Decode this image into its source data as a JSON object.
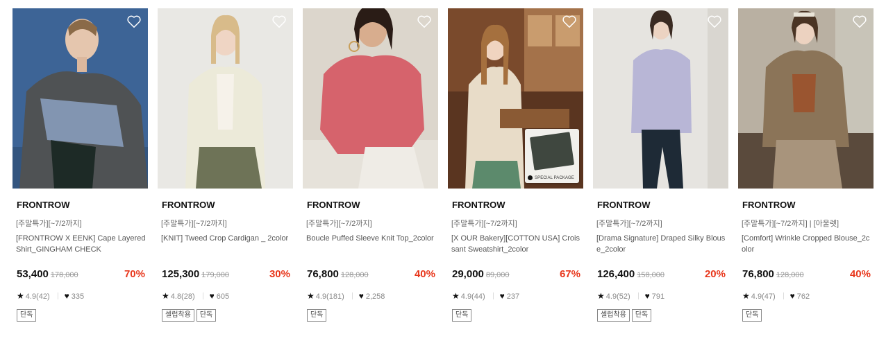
{
  "products": [
    {
      "brand": "FRONTROW",
      "promo": "[주말특가][~7/2까지]",
      "name": "[FRONTROW X EENK] Cape Layered Shirt_GINGHAM CHECK",
      "price": "53,400",
      "original_price": "178,000",
      "discount": "70%",
      "rating": "4.9(42)",
      "likes": "335",
      "tags": [
        "단독"
      ],
      "colors": {
        "bg": "#3d6496",
        "garment": "#55585a"
      }
    },
    {
      "brand": "FRONTROW",
      "promo": "[주말특가][~7/2까지]",
      "name": "[KNIT] Tweed Crop Cardigan _ 2color",
      "price": "125,300",
      "original_price": "179,000",
      "discount": "30%",
      "rating": "4.8(28)",
      "likes": "605",
      "tags": [
        "셀럽착용",
        "단독"
      ],
      "colors": {
        "bg": "#e9e8e4",
        "garment": "#ecead9"
      }
    },
    {
      "brand": "FRONTROW",
      "promo": "[주말특가][~7/2까지]",
      "name": "Boucle Puffed Sleeve Knit Top_2color",
      "price": "76,800",
      "original_price": "128,000",
      "discount": "40%",
      "rating": "4.9(181)",
      "likes": "2,258",
      "tags": [
        "단독"
      ],
      "colors": {
        "bg": "#dcd6cc",
        "garment": "#d6636c"
      }
    },
    {
      "brand": "FRONTROW",
      "promo": "[주말특가][~7/2까지]",
      "name": "[X OUR Bakery][COTTON USA] Croissant Sweatshirt_2color",
      "price": "29,000",
      "original_price": "89,000",
      "discount": "67%",
      "rating": "4.9(44)",
      "likes": "237",
      "tags": [
        "단독"
      ],
      "badge": "SPECIAL PACKAGE",
      "colors": {
        "bg": "#7a4a2c",
        "garment": "#e8dcc8"
      }
    },
    {
      "brand": "FRONTROW",
      "promo": "[주말특가][~7/2까지]",
      "name": "[Drama Signature] Draped Silky Blouse_2color",
      "price": "126,400",
      "original_price": "158,000",
      "discount": "20%",
      "rating": "4.9(52)",
      "likes": "791",
      "tags": [
        "셀럽착용",
        "단독"
      ],
      "colors": {
        "bg": "#e6e4e0",
        "garment": "#b8b6d6"
      }
    },
    {
      "brand": "FRONTROW",
      "promo": "[주말특가][~7/2까지] | [아울렛]",
      "name": "[Comfort] Wrinkle Cropped Blouse_2color",
      "price": "76,800",
      "original_price": "128,000",
      "discount": "40%",
      "rating": "4.9(47)",
      "likes": "762",
      "tags": [
        "단독"
      ],
      "colors": {
        "bg": "#b9b0a2",
        "garment": "#8b7458"
      }
    }
  ]
}
